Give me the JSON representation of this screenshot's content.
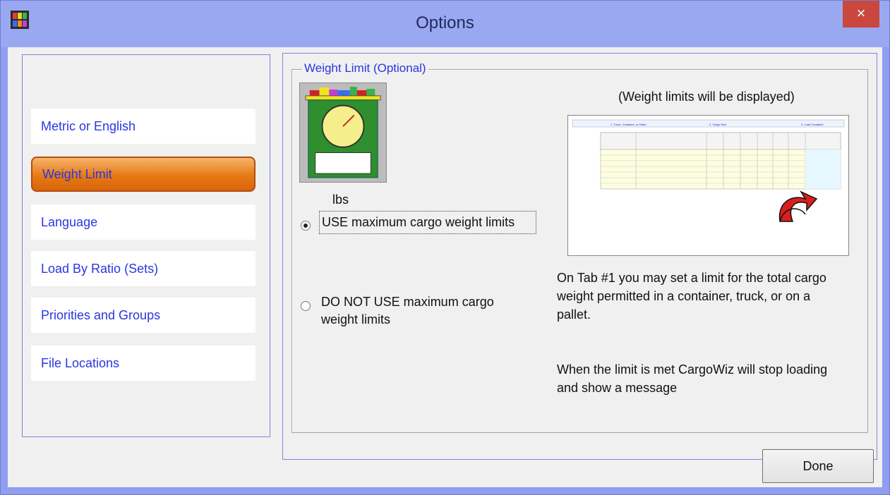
{
  "window": {
    "title": "Options",
    "close_label": "×"
  },
  "sidebar": {
    "items": [
      {
        "label": "Metric or English",
        "active": false
      },
      {
        "label": "Weight Limit",
        "active": true
      },
      {
        "label": "Language",
        "active": false
      },
      {
        "label": "Load By Ratio (Sets)",
        "active": false
      },
      {
        "label": "Priorities and Groups",
        "active": false
      },
      {
        "label": "File Locations",
        "active": false
      }
    ]
  },
  "weight_limit": {
    "group_title": "Weight Limit (Optional)",
    "unit_label": "lbs",
    "options": [
      {
        "label": "USE maximum cargo weight limits",
        "checked": true
      },
      {
        "label": "DO NOT USE maximum cargo weight limits",
        "checked": false
      }
    ],
    "display_note": "(Weight limits will be displayed)",
    "info_1": "On Tab #1 you may set a limit for the total cargo weight permitted in a container, truck, or on a pallet.",
    "info_2": "When the limit is met CargoWiz will stop loading and show a message"
  },
  "preview": {
    "tabs": [
      "1. Truck, Container, or Pallet",
      "2. Cargo Size",
      "3. Load Container"
    ]
  },
  "footer": {
    "done_label": "Done"
  },
  "colors": {
    "accent": "#2a36e0",
    "active_tab": "#e67915",
    "title_bar": "#9aa8f2",
    "close": "#c9473d"
  }
}
